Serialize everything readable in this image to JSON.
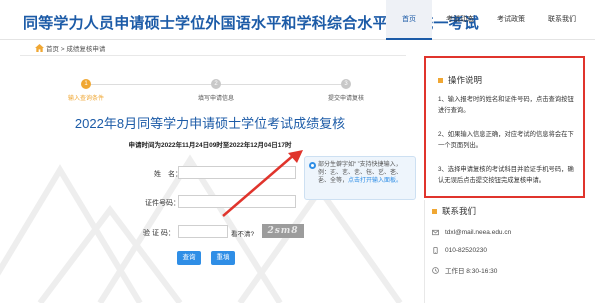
{
  "header": {
    "title": "同等学力人员申请硕士学位外国语水平和学科综合水平全国统一考试",
    "nav": [
      "首页",
      "考试动态",
      "考试政策",
      "联系我们"
    ]
  },
  "breadcrumb": "首页 > 成绩复核申请",
  "steps": [
    {
      "num": "1",
      "label": "输入查询条件"
    },
    {
      "num": "2",
      "label": "填写申请信息"
    },
    {
      "num": "3",
      "label": "提交申请复核"
    }
  ],
  "main_title": "2022年8月同等学力申请硕士学位考试成绩复核",
  "period": "申请时间为2022年11月24日09时至2022年12月04日17时",
  "form": {
    "name_label": "姓　名：",
    "id_label": "证件号码：",
    "captcha_label": "验 证 码：",
    "captcha_question": "看不清?",
    "captcha_text": "2sm8",
    "query_button": "查询",
    "reset_button": "重填"
  },
  "hint": {
    "text": "部分生僻字如“ ”支持快捷输入，例：㐉、㐊、㐋、㐌、㐍、㐎、㐏、全等，",
    "link": "点击打开输入面板。"
  },
  "sidebar": {
    "notice_title": "操作说明",
    "notice_items": [
      "1、输入报考时的姓名和证件号码，点击查询按钮进行查询。",
      "2、如果输入信息正确，对应考试的信息将会在下一个页面列出。",
      "3、选择申请复核的考试科目并验证手机号码，确认无误后点击提交按钮完成复核申请。"
    ],
    "contact_title": "联系我们",
    "contacts": [
      {
        "icon": "email-icon",
        "text": "tdxl@mail.neea.edu.cn"
      },
      {
        "icon": "phone-icon",
        "text": "010-82520230"
      },
      {
        "icon": "clock-icon",
        "text": "工作日 8:30-16:30"
      }
    ]
  },
  "colors": {
    "brand": "#1c5ba7",
    "accent": "#f0a733",
    "button": "#2f8ee6",
    "highlight": "#e0342c"
  }
}
